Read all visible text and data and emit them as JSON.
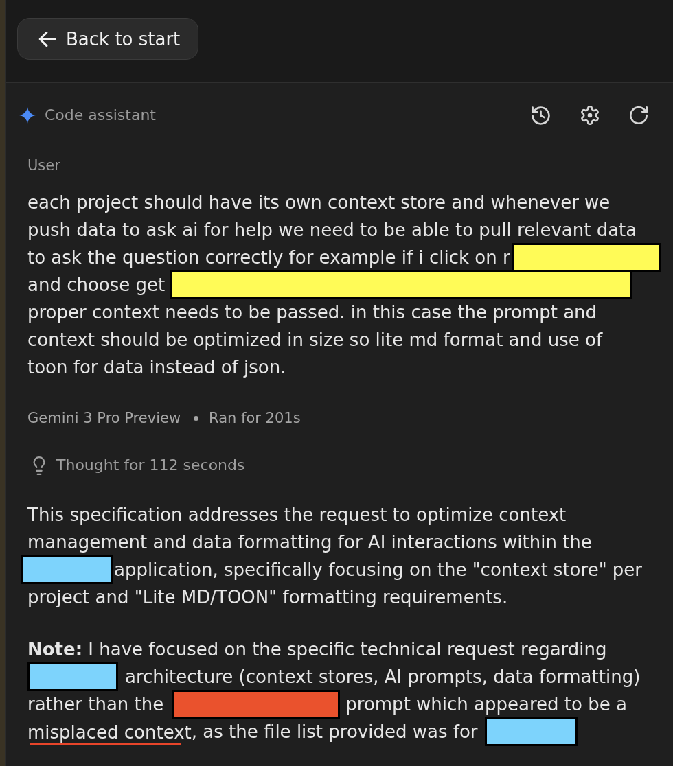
{
  "back_button": {
    "label": "Back to start"
  },
  "assistant": {
    "title": "Code assistant"
  },
  "messages": [
    {
      "kind": "user",
      "author": "User",
      "paragraphs": [
        {
          "segments": [
            {
              "kind": "text",
              "text": "each project should have its own context store and whenever we push data to ask ai for help we need to be able to pull relevant data"
            },
            {
              "kind": "text",
              "text": "to ask the question correctly for example if i click on r"
            },
            {
              "kind": "redaction",
              "color": "#fffb57"
            },
            {
              "kind": "text",
              "text": "and choose get"
            },
            {
              "kind": "redaction",
              "color": "#fffb57"
            },
            {
              "kind": "text",
              "text": "proper context needs to be passed. in this case the prompt and context should be optimized in size so lite md format and use of toon for data instead of json."
            }
          ]
        }
      ]
    },
    {
      "kind": "model",
      "model": "Gemini 3 Pro Preview",
      "run_time": "Ran for 201s",
      "thought": "Thought for 112 seconds",
      "paragraphs": [
        {
          "segments": [
            {
              "kind": "text",
              "text": "This specification addresses the request to optimize context management and data formatting for AI interactions within the"
            },
            {
              "kind": "redaction",
              "color": "#7dd3fc"
            },
            {
              "kind": "text",
              "text": "application, specifically focusing on the \"context store\" per"
            },
            {
              "kind": "text",
              "text": "project and \"Lite MD/TOON\" formatting requirements."
            }
          ]
        },
        {
          "segments": [
            {
              "kind": "text",
              "text": "**Note:** I have focused on the specific technical request regarding"
            },
            {
              "kind": "redaction",
              "color": "#7dd3fc"
            },
            {
              "kind": "text",
              "text": "architecture (context stores, AI prompts, data formatting)"
            },
            {
              "kind": "text",
              "text": "rather than the"
            },
            {
              "kind": "redaction",
              "color": "#ea522d"
            },
            {
              "kind": "text",
              "text": "prompt which appeared to be a"
            },
            {
              "kind": "marked",
              "text": "misplaced context"
            },
            {
              "kind": "text",
              "text": ", as the file list provided was for"
            },
            {
              "kind": "redaction",
              "color": "#7dd3fc"
            }
          ]
        }
      ]
    }
  ]
}
